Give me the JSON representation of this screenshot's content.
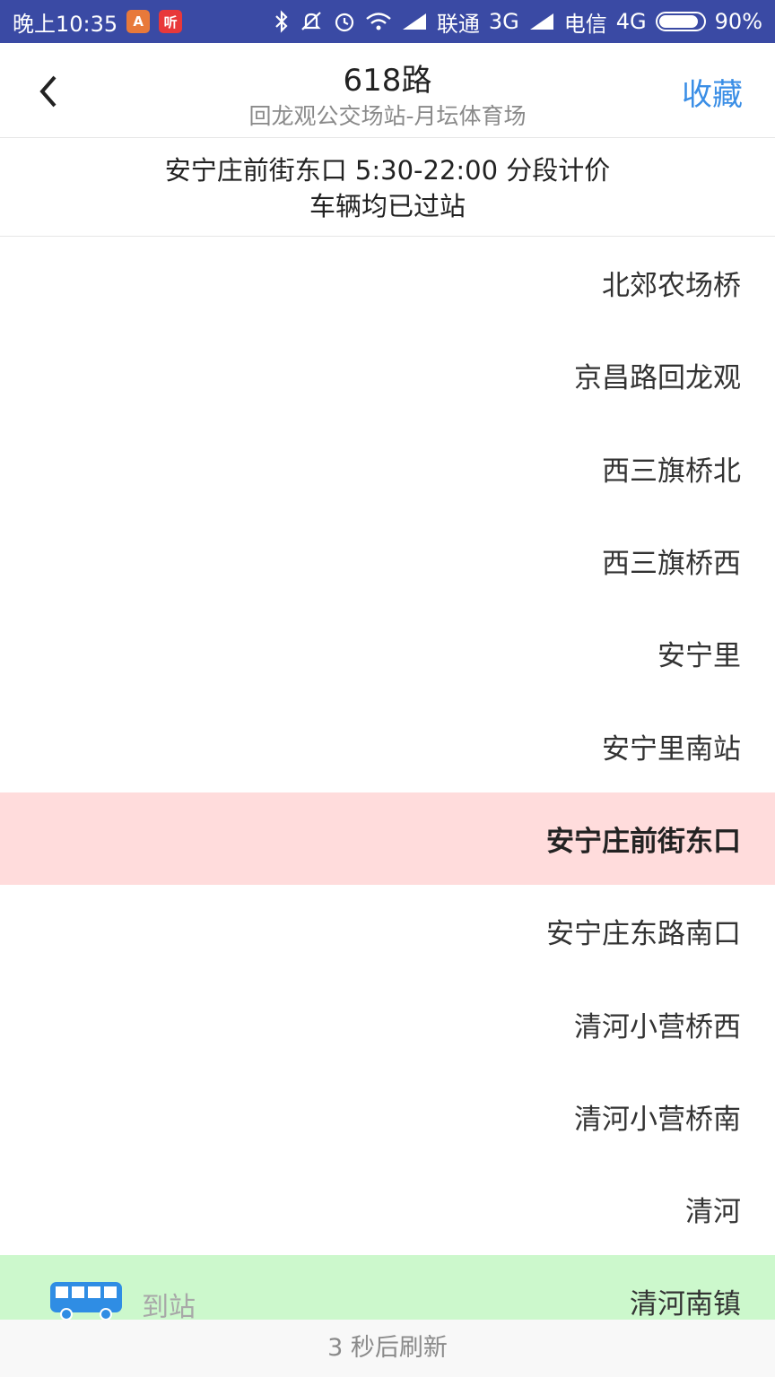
{
  "status_bar": {
    "time": "晚上10:35",
    "badge_shield": "A",
    "badge_listen": "听",
    "carrier1": "联通",
    "net1": "3G",
    "carrier2": "电信",
    "net2": "4G",
    "battery": "90%",
    "battery_level": 0.9,
    "bar_color": "#3a4aa4"
  },
  "header": {
    "title": "618路",
    "subtitle": "回龙观公交场站-月坛体育场",
    "favorite_label": "收藏",
    "accent": "#3a8ee6"
  },
  "info": {
    "line1": "安宁庄前街东口 5:30-22:00 分段计价",
    "line2": "车辆均已过站"
  },
  "stops": [
    {
      "name": "北郊农场桥"
    },
    {
      "name": "京昌路回龙观"
    },
    {
      "name": "西三旗桥北"
    },
    {
      "name": "西三旗桥西"
    },
    {
      "name": "安宁里"
    },
    {
      "name": "安宁里南站"
    },
    {
      "name": "安宁庄前街东口",
      "state": "current",
      "highlight": "#ffdcdc"
    },
    {
      "name": "安宁庄东路南口"
    },
    {
      "name": "清河小营桥西"
    },
    {
      "name": "清河小营桥南"
    },
    {
      "name": "清河"
    },
    {
      "name": "清河南镇",
      "state": "arrived",
      "highlight": "#ccf8cc",
      "bus_icon": "bus-icon",
      "bus_label": "到站"
    }
  ],
  "footer": {
    "refresh_text": "3 秒后刷新"
  }
}
